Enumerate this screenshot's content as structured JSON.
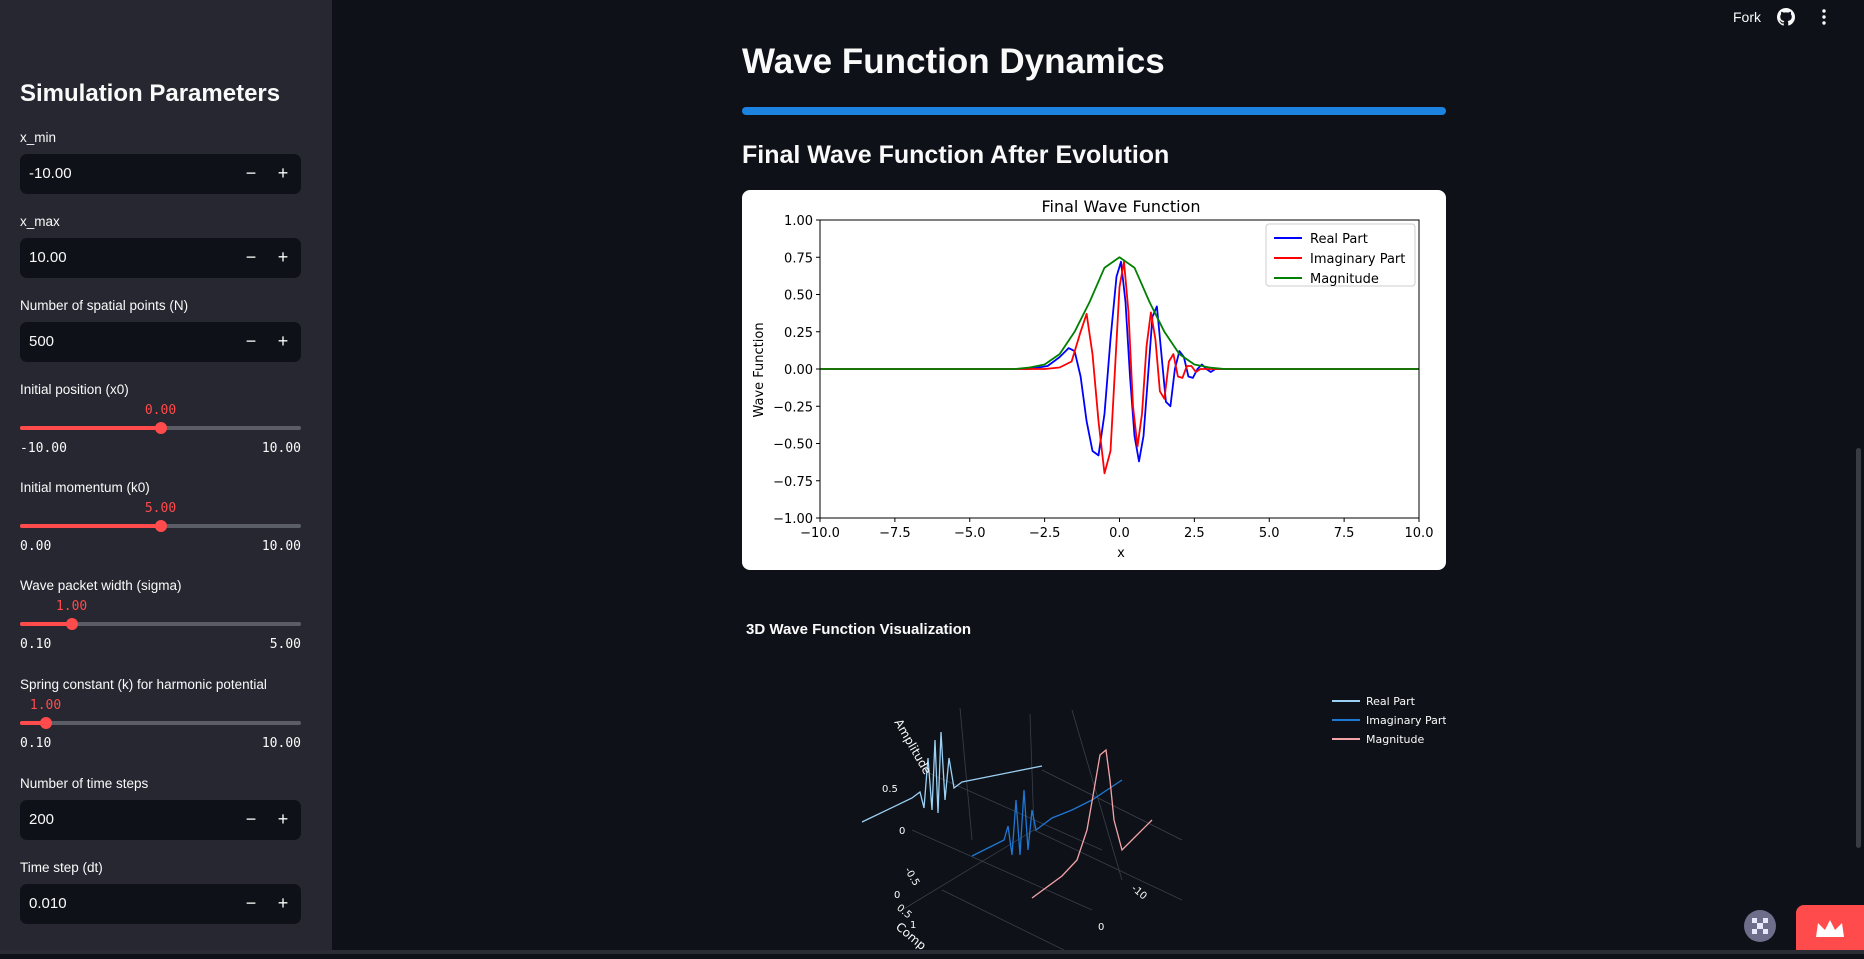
{
  "header": {
    "fork_label": "Fork"
  },
  "sidebar": {
    "title": "Simulation Parameters",
    "x_min": {
      "label": "x_min",
      "value": "-10.00"
    },
    "x_max": {
      "label": "x_max",
      "value": "10.00"
    },
    "n_points": {
      "label": "Number of spatial points (N)",
      "value": "500"
    },
    "x0": {
      "label": "Initial position (x0)",
      "value": "0.00",
      "min": "-10.00",
      "max": "10.00",
      "fraction": 0.5
    },
    "k0": {
      "label": "Initial momentum (k0)",
      "value": "5.00",
      "min": "0.00",
      "max": "10.00",
      "fraction": 0.5
    },
    "sigma": {
      "label": "Wave packet width (sigma)",
      "value": "1.00",
      "min": "0.10",
      "max": "5.00",
      "fraction": 0.1837
    },
    "spring": {
      "label": "Spring constant (k) for harmonic potential",
      "value": "1.00",
      "min": "0.10",
      "max": "10.00",
      "fraction": 0.0909
    },
    "time_steps": {
      "label": "Number of time steps",
      "value": "200"
    },
    "dt": {
      "label": "Time step (dt)",
      "value": "0.010"
    }
  },
  "main": {
    "title": "Wave Function Dynamics",
    "subtitle": "Final Wave Function After Evolution",
    "plot3d_title": "3D Wave Function Visualization",
    "plot3d_legend": [
      "Real Part",
      "Imaginary Part",
      "Magnitude"
    ],
    "plot3d_axis_labels": [
      "Amplitude",
      "Comp"
    ],
    "plot3d_ticks": [
      "0.5",
      "0",
      "-0.5",
      "0",
      "0.5",
      "1",
      "0",
      "-10"
    ]
  },
  "chart_data": {
    "type": "line",
    "title": "Final Wave Function",
    "xlabel": "x",
    "ylabel": "Wave Function",
    "xlim": [
      -10,
      10
    ],
    "ylim": [
      -1,
      1
    ],
    "xticks": [
      "−10.0",
      "−7.5",
      "−5.0",
      "−2.5",
      "0.0",
      "2.5",
      "5.0",
      "7.5",
      "10.0"
    ],
    "yticks": [
      "−1.00",
      "−0.75",
      "−0.50",
      "−0.25",
      "0.00",
      "0.25",
      "0.50",
      "0.75",
      "1.00"
    ],
    "legend_position": "top-right",
    "series": [
      {
        "name": "Real Part",
        "color": "#0000ff",
        "x": [
          -10,
          -3.0,
          -2.4,
          -2.0,
          -1.7,
          -1.5,
          -1.3,
          -1.1,
          -0.9,
          -0.7,
          -0.5,
          -0.3,
          -0.1,
          0.05,
          0.2,
          0.35,
          0.5,
          0.65,
          0.8,
          0.95,
          1.1,
          1.25,
          1.4,
          1.55,
          1.7,
          1.85,
          2.0,
          2.15,
          2.3,
          2.45,
          2.6,
          2.75,
          2.9,
          3.05,
          3.2,
          3.4,
          10
        ],
        "y": [
          0,
          0,
          0.02,
          0.08,
          0.14,
          0.12,
          -0.05,
          -0.35,
          -0.55,
          -0.58,
          -0.3,
          0.2,
          0.62,
          0.72,
          0.45,
          -0.05,
          -0.45,
          -0.62,
          -0.45,
          -0.05,
          0.35,
          0.42,
          0.1,
          -0.22,
          -0.25,
          0.0,
          0.12,
          0.08,
          -0.05,
          -0.06,
          0.0,
          0.03,
          0.0,
          -0.02,
          0.0,
          0.0,
          0
        ]
      },
      {
        "name": "Imaginary Part",
        "color": "#ff0000",
        "x": [
          -10,
          -3.0,
          -2.5,
          -2.0,
          -1.6,
          -1.3,
          -1.1,
          -0.9,
          -0.7,
          -0.5,
          -0.3,
          -0.15,
          0.0,
          0.15,
          0.3,
          0.45,
          0.6,
          0.75,
          0.9,
          1.05,
          1.2,
          1.35,
          1.5,
          1.65,
          1.8,
          1.95,
          2.1,
          2.25,
          2.4,
          2.55,
          2.7,
          2.85,
          3.0,
          3.3,
          10
        ],
        "y": [
          0,
          0,
          0.0,
          0.01,
          0.05,
          0.25,
          0.37,
          0.1,
          -0.35,
          -0.7,
          -0.55,
          0.0,
          0.55,
          0.72,
          0.38,
          -0.25,
          -0.52,
          -0.3,
          0.15,
          0.38,
          0.2,
          -0.15,
          -0.2,
          0.05,
          0.1,
          -0.05,
          -0.06,
          0.02,
          0.02,
          -0.02,
          0.0,
          0.0,
          0.0,
          0.0,
          0
        ]
      },
      {
        "name": "Magnitude",
        "color": "#008000",
        "x": [
          -10,
          -4,
          -3.5,
          -3.0,
          -2.5,
          -2.0,
          -1.5,
          -1.0,
          -0.5,
          0.0,
          0.5,
          1.0,
          1.5,
          2.0,
          2.5,
          3.0,
          3.5,
          4,
          10
        ],
        "y": [
          0,
          0.0,
          0.0,
          0.01,
          0.03,
          0.1,
          0.25,
          0.45,
          0.68,
          0.75,
          0.68,
          0.45,
          0.25,
          0.1,
          0.03,
          0.01,
          0.0,
          0.0,
          0
        ]
      }
    ]
  }
}
